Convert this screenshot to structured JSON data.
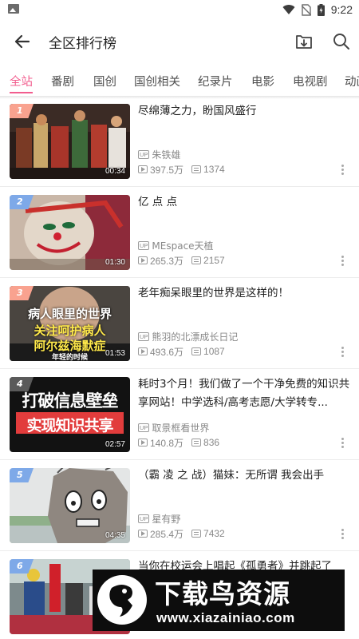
{
  "status_bar": {
    "time": "9:22",
    "icons": [
      "gallery-icon",
      "wifi-icon",
      "no-sim-icon",
      "battery-icon"
    ]
  },
  "app_bar": {
    "title": "全区排行榜",
    "back_icon": "arrow-left-icon",
    "download_icon": "download-icon",
    "search_icon": "search-icon"
  },
  "tabs": {
    "active": "全站",
    "items": [
      "全站",
      "番剧",
      "国创",
      "国创相关",
      "纪录片",
      "电影",
      "电视剧",
      "动画"
    ],
    "accent_color": "#f25d8e"
  },
  "videos": [
    {
      "rank": "1",
      "title": "尽绵薄之力，盼国风盛行",
      "duration": "00:34",
      "uploader": "朱铁雄",
      "views": "397.5万",
      "danmaku": "1374"
    },
    {
      "rank": "2",
      "title": "亿 点 点",
      "duration": "01:30",
      "uploader": "MEspace天植",
      "views": "265.3万",
      "danmaku": "2157"
    },
    {
      "rank": "3",
      "title": "老年痴呆眼里的世界是这样的！",
      "duration": "01:53",
      "uploader": "熊羽的北漂成长日记",
      "views": "493.6万",
      "danmaku": "1087",
      "thumb_text": [
        "病人眼里的世界",
        "关注呵护病人",
        "阿尔兹海默症",
        "年轻的时候"
      ]
    },
    {
      "rank": "4",
      "title": "耗时3个月！我们做了一个干净免费的知识共享网站！中学选科/高考志愿/大学转专...",
      "duration": "02:57",
      "uploader": "取景框看世界",
      "views": "140.8万",
      "danmaku": "836",
      "thumb_text": [
        "打破信息壁垒",
        "实现知识共享"
      ]
    },
    {
      "rank": "5",
      "title": "（霸 凌 之 战）猫妹：无所谓 我会出手",
      "duration": "04:35",
      "uploader": "星有野",
      "views": "285.4万",
      "danmaku": "7432"
    },
    {
      "rank": "6",
      "title": "当你在校运会上唱起《孤勇者》并跳起了",
      "duration": "",
      "uploader": "",
      "views": "",
      "danmaku": ""
    }
  ],
  "up_badge": "UP",
  "watermark": {
    "main": "下载鸟资源",
    "url": "www.xiazainiao.com"
  }
}
